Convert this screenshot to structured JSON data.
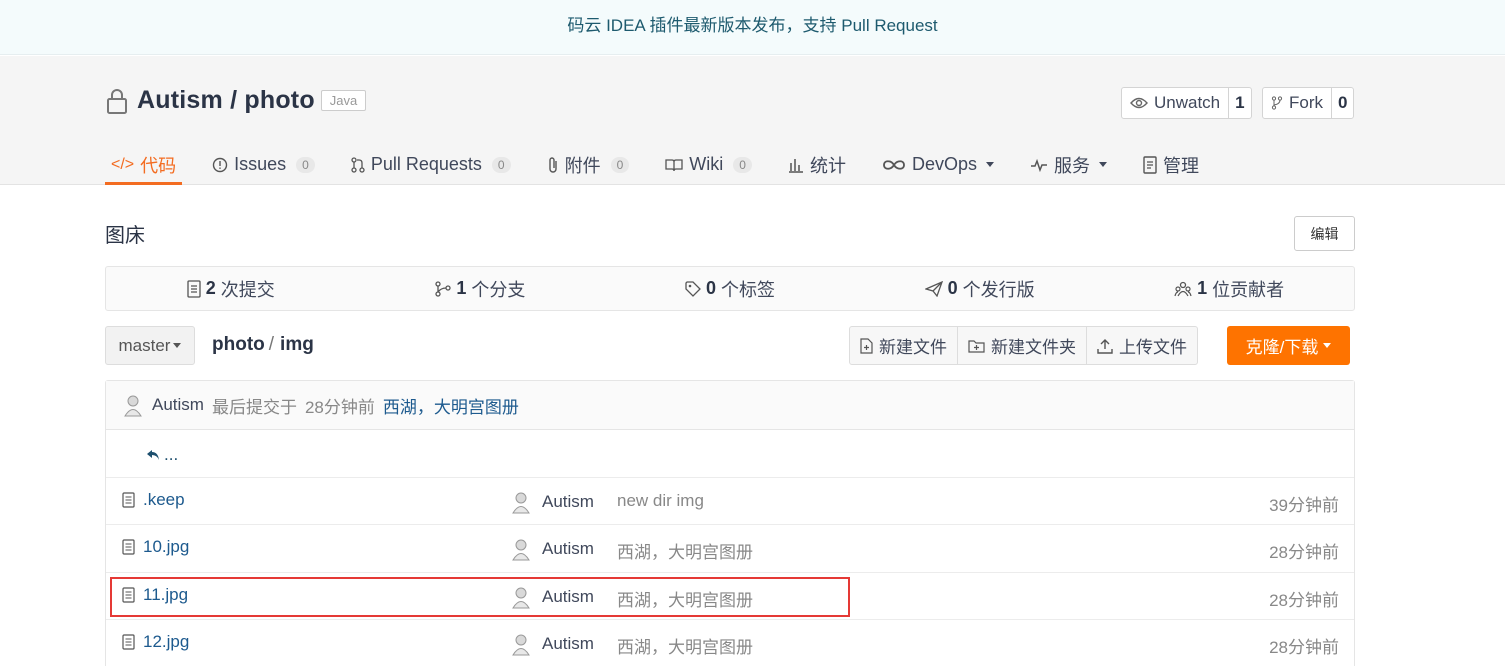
{
  "announcement": "码云 IDEA 插件最新版本发布，支持 Pull Request",
  "repo": {
    "owner": "Autism",
    "separator": " / ",
    "name": "photo",
    "language": "Java"
  },
  "actions": {
    "watch_label": "Unwatch",
    "watch_count": "1",
    "fork_label": "Fork",
    "fork_count": "0"
  },
  "tabs": [
    {
      "label": "代码"
    },
    {
      "label": "Issues",
      "count": "0"
    },
    {
      "label": "Pull Requests",
      "count": "0"
    },
    {
      "label": "附件",
      "count": "0"
    },
    {
      "label": "Wiki",
      "count": "0"
    },
    {
      "label": "统计"
    },
    {
      "label": "DevOps"
    },
    {
      "label": "服务"
    },
    {
      "label": "管理"
    }
  ],
  "description": "图床",
  "edit_label": "编辑",
  "stats": [
    {
      "num": "2",
      "label": "次提交"
    },
    {
      "num": "1",
      "label": "个分支"
    },
    {
      "num": "0",
      "label": "个标签"
    },
    {
      "num": "0",
      "label": "个发行版"
    },
    {
      "num": "1",
      "label": "位贡献者"
    }
  ],
  "toolbar": {
    "branch": "master",
    "crumb_repo": "photo",
    "crumb_sep": "/",
    "crumb_dir": "img",
    "new_file": "新建文件",
    "new_folder": "新建文件夹",
    "upload": "上传文件",
    "clone": "克隆/下载"
  },
  "last_commit": {
    "author": "Autism",
    "prefix": "最后提交于",
    "time": "28分钟前",
    "message": "西湖，大明宫图册"
  },
  "parent_dir": "...",
  "files": [
    {
      "name": ".keep",
      "author": "Autism",
      "message": "new dir img",
      "time": "39分钟前"
    },
    {
      "name": "10.jpg",
      "author": "Autism",
      "message": "西湖，大明宫图册",
      "time": "28分钟前"
    },
    {
      "name": "11.jpg",
      "author": "Autism",
      "message": "西湖，大明宫图册",
      "time": "28分钟前"
    },
    {
      "name": "12.jpg",
      "author": "Autism",
      "message": "西湖，大明宫图册",
      "time": "28分钟前"
    }
  ],
  "colors": {
    "accent": "#f36c21",
    "clone_button": "#fe7300",
    "highlight": "#e53935"
  }
}
